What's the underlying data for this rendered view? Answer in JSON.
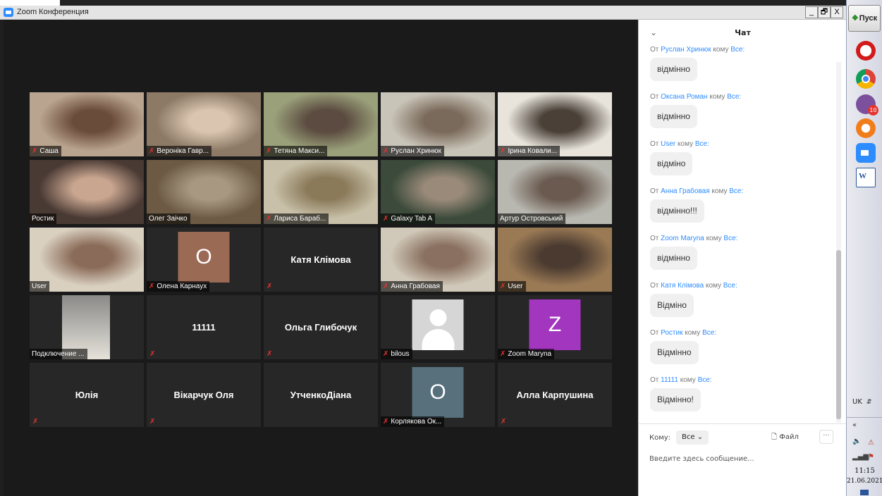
{
  "window": {
    "title": "Zoom Конференция",
    "controls": {
      "minimize": "_",
      "restore": "🗗",
      "close": "X"
    }
  },
  "gallery": {
    "tiles": [
      {
        "name": "Саша",
        "muted": true,
        "kind": "video"
      },
      {
        "name": "Вероніка Гавр...",
        "muted": true,
        "kind": "video"
      },
      {
        "name": "Тетяна Макси...",
        "muted": true,
        "kind": "video"
      },
      {
        "name": "Руслан Хринюк",
        "muted": true,
        "kind": "video"
      },
      {
        "name": "Ірина Ковали...",
        "muted": true,
        "kind": "video"
      },
      {
        "name": "Ростик",
        "muted": false,
        "kind": "video"
      },
      {
        "name": "Олег Заічко",
        "muted": false,
        "kind": "video",
        "active": true
      },
      {
        "name": "Лариса Бараб...",
        "muted": true,
        "kind": "video"
      },
      {
        "name": "Galaxy Tab A",
        "muted": true,
        "kind": "video"
      },
      {
        "name": "Артур Островський",
        "muted": false,
        "kind": "video"
      },
      {
        "name": "User",
        "muted": false,
        "kind": "video"
      },
      {
        "name": "Олена Карнаух",
        "muted": true,
        "kind": "avatar",
        "initial": "O",
        "color": "#9b6a55"
      },
      {
        "name": "Катя Клімова",
        "muted": true,
        "kind": "text"
      },
      {
        "name": "Анна Грабовая",
        "muted": true,
        "kind": "video"
      },
      {
        "name": "User",
        "muted": true,
        "kind": "video"
      },
      {
        "name": "Подключение ...",
        "muted": false,
        "kind": "video"
      },
      {
        "name": "11111",
        "muted": true,
        "kind": "text"
      },
      {
        "name": "Ольга Глибочук",
        "muted": true,
        "kind": "text"
      },
      {
        "name": "bilous",
        "muted": true,
        "kind": "avatar-generic"
      },
      {
        "name": "Zoom Maryna",
        "muted": true,
        "kind": "avatar",
        "initial": "Z",
        "color": "#a236bf"
      },
      {
        "name": "Юлія",
        "muted": true,
        "kind": "text"
      },
      {
        "name": "Вікарчук Оля",
        "muted": true,
        "kind": "text"
      },
      {
        "name": "УтченкоДіана",
        "muted": false,
        "kind": "text"
      },
      {
        "name": "Корлякова Ок...",
        "muted": true,
        "kind": "avatar",
        "initial": "O",
        "color": "#57707c"
      },
      {
        "name": "Алла Карпушина",
        "muted": true,
        "kind": "text"
      }
    ]
  },
  "chat": {
    "title": "Чат",
    "from_word": "От",
    "to_word": "кому",
    "messages": [
      {
        "from": "Руслан Хринюк",
        "to": "Все:",
        "text": "відмінно"
      },
      {
        "from": "Оксана Роман",
        "to": "Все:",
        "text": "відмінно"
      },
      {
        "from": "User",
        "to": "Все:",
        "text": "відміно"
      },
      {
        "from": "Анна Грабовая",
        "to": "Все:",
        "text": "відмінно!!!"
      },
      {
        "from": "Zoom Maryna",
        "to": "Все:",
        "text": "відмінно"
      },
      {
        "from": "Катя Клімова",
        "to": "Все:",
        "text": "Відміно"
      },
      {
        "from": "Ростик",
        "to": "Все:",
        "text": "Відмінно"
      },
      {
        "from": "11111",
        "to": "Все:",
        "text": "Відмінно!"
      }
    ],
    "footer": {
      "to_label": "Кому:",
      "recipient": "Все",
      "file_label": "Файл",
      "more": "···",
      "placeholder": "Введите здесь сообщение..."
    }
  },
  "taskbar": {
    "start_label": "Пуск",
    "language": "UK",
    "time": "11:15",
    "date": "21.06.2021",
    "viber_badge": "10"
  },
  "colors": {
    "accent": "#2d8cff",
    "muted_mic": "#e3342f",
    "active_speaker": "#d9e26a"
  }
}
